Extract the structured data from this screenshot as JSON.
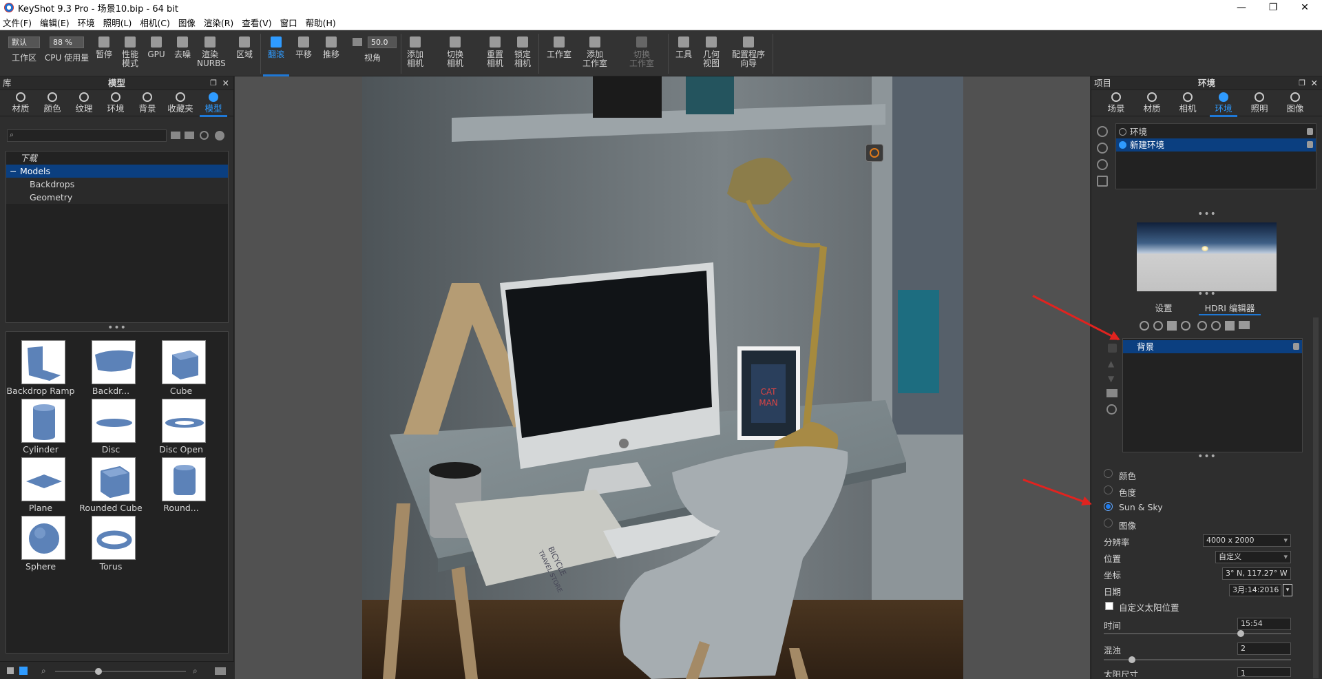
{
  "window": {
    "title": "KeyShot 9.3 Pro  - 场景10.bip  - 64 bit",
    "minimize": "—",
    "maximize": "❐",
    "close": "✕"
  },
  "menu": [
    "文件(F)",
    "编辑(E)",
    "环境",
    "照明(L)",
    "相机(C)",
    "图像",
    "渲染(R)",
    "查看(V)",
    "窗口",
    "帮助(H)"
  ],
  "toolbar": {
    "workspace_select": "默认",
    "workspace_label": "工作区",
    "cpu_percent": "88 %",
    "cpu_label": "CPU 使用量",
    "pause": "暂停",
    "perf_line1": "性能",
    "perf_line2": "模式",
    "gpu": "GPU",
    "denoise": "去噪",
    "nurbs_line1": "渲染",
    "nurbs_line2": "NURBS",
    "region": "区域",
    "tumble": "翻滚",
    "pan": "平移",
    "dolly": "推移",
    "fov_value": "50.0",
    "fov_label": "视角",
    "addcam_line1": "添加",
    "addcam_line2": "相机",
    "switchcam_line1": "切换",
    "switchcam_line2": "相机",
    "resetcam_line1": "重置",
    "resetcam_line2": "相机",
    "lockcam_line1": "锁定",
    "lockcam_line2": "相机",
    "studio": "工作室",
    "addstudio_line1": "添加",
    "addstudio_line2": "工作室",
    "switchstudio_line1": "切换",
    "switchstudio_line2": "工作室",
    "tools": "工具",
    "geom_line1": "几何",
    "geom_line2": "视图",
    "config_line1": "配置程序",
    "config_line2": "向导"
  },
  "library": {
    "panel_label": "库",
    "panel_title": "模型",
    "tabs": [
      "材质",
      "颜色",
      "纹理",
      "环境",
      "背景",
      "收藏夹",
      "模型"
    ],
    "search_placeholder": "",
    "tree": [
      "下载",
      "Models",
      "Backdrops",
      "Geometry"
    ],
    "models": [
      "Backdrop Ramp",
      "Backdr...",
      "Cube",
      "Cylinder",
      "Disc",
      "Disc Open",
      "Plane",
      "Rounded Cube",
      "Round...",
      "Sphere",
      "Torus"
    ]
  },
  "viewport": {
    "poster_line1": "CAT",
    "poster_line2": "MAN",
    "book_line1": "BICYCLE",
    "book_line2": "TRAVEL STORE"
  },
  "project": {
    "panel_label": "项目",
    "panel_title": "环境",
    "tabs": [
      "场景",
      "材质",
      "相机",
      "环境",
      "照明",
      "图像"
    ],
    "env_list": [
      "环境",
      "新建环境"
    ],
    "subtabs": [
      "设置",
      "HDRI 编辑器"
    ],
    "layer": "背景",
    "bg_options": [
      "颜色",
      "色度",
      "Sun & Sky",
      "图像"
    ],
    "resolution_label": "分辨率",
    "resolution_value": "4000 x 2000",
    "location_label": "位置",
    "location_value": "自定义",
    "coord_label": "坐标",
    "coord_value": "3°  N, 117.27°  W",
    "date_label": "日期",
    "date_value": "3月:14:2016",
    "custom_sun_label": "自定义太阳位置",
    "time_label": "时间",
    "time_value": "15:54",
    "turbidity_label": "混浊",
    "turbidity_value": "2",
    "sunsize_label": "太阳尺寸",
    "sunsize_value": "1"
  },
  "colors": {
    "accent": "#2f9bff",
    "selection": "#0b3f80",
    "arrow": "#e1231f"
  }
}
